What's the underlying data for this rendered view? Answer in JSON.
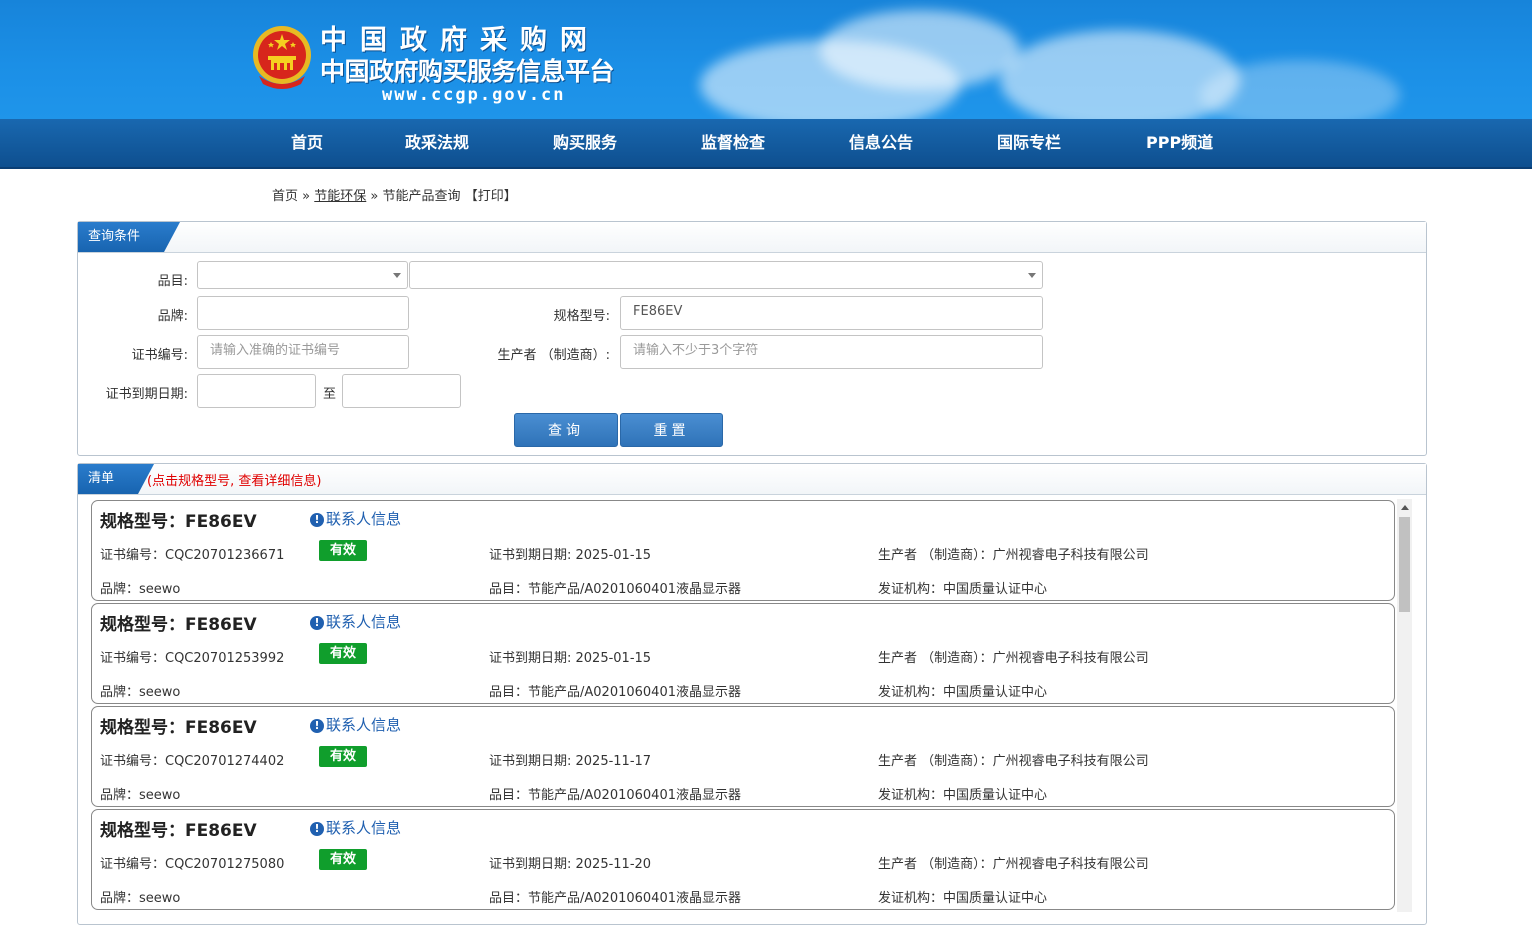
{
  "header": {
    "title": "中国政府采购网",
    "subtitle": "中国政府购买服务信息平台",
    "url": "www.ccgp.gov.cn"
  },
  "nav": {
    "items": [
      "首页",
      "政采法规",
      "购买服务",
      "监督检查",
      "信息公告",
      "国际专栏",
      "PPP频道"
    ]
  },
  "breadcrumb": {
    "home": "首页",
    "sep1": "»",
    "section": "节能环保",
    "sep2": "»",
    "current": "节能产品查询",
    "print": "【打印】"
  },
  "query": {
    "tab": "查询条件",
    "category_label": "品目:",
    "brand_label": "品牌:",
    "brand_value": "",
    "model_label": "规格型号:",
    "model_value": "FE86EV",
    "cert_label": "证书编号:",
    "cert_placeholder": "请输入准确的证书编号",
    "maker_label": "生产者 （制造商）:",
    "maker_placeholder": "请输入不少于3个字符",
    "expiry_label": "证书到期日期:",
    "to_label": "至",
    "search_button": "查询",
    "reset_button": "重置"
  },
  "list": {
    "tab": "清单",
    "hint": "(点击规格型号, 查看详细信息)",
    "contact_label": "联系人信息",
    "items": [
      {
        "title": "规格型号：FE86EV",
        "cert_no": "证书编号：CQC20701236671",
        "status": "有效",
        "expiry": "证书到期日期: 2025-01-15",
        "maker": "生产者 （制造商）：广州视睿电子科技有限公司",
        "brand": "品牌：seewo",
        "category": "品目：节能产品/A0201060401液晶显示器",
        "issuer": "发证机构：中国质量认证中心"
      },
      {
        "title": "规格型号：FE86EV",
        "cert_no": "证书编号：CQC20701253992",
        "status": "有效",
        "expiry": "证书到期日期: 2025-01-15",
        "maker": "生产者 （制造商）：广州视睿电子科技有限公司",
        "brand": "品牌：seewo",
        "category": "品目：节能产品/A0201060401液晶显示器",
        "issuer": "发证机构：中国质量认证中心"
      },
      {
        "title": "规格型号：FE86EV",
        "cert_no": "证书编号：CQC20701274402",
        "status": "有效",
        "expiry": "证书到期日期: 2025-11-17",
        "maker": "生产者 （制造商）：广州视睿电子科技有限公司",
        "brand": "品牌：seewo",
        "category": "品目：节能产品/A0201060401液晶显示器",
        "issuer": "发证机构：中国质量认证中心"
      },
      {
        "title": "规格型号：FE86EV",
        "cert_no": "证书编号：CQC20701275080",
        "status": "有效",
        "expiry": "证书到期日期: 2025-11-20",
        "maker": "生产者 （制造商）：广州视睿电子科技有限公司",
        "brand": "品牌：seewo",
        "category": "品目：节能产品/A0201060401液晶显示器",
        "issuer": "发证机构：中国质量认证中心"
      }
    ]
  },
  "colors": {
    "banner_blue": "#1b8fe6",
    "nav_blue": "#0e4f8f",
    "valid_green": "#109e2c",
    "hint_red": "#e00000",
    "link_blue": "#2060b0"
  },
  "icons": {
    "emblem": "national-emblem-icon",
    "info": "info-icon",
    "dropdown": "chevron-down-icon"
  }
}
